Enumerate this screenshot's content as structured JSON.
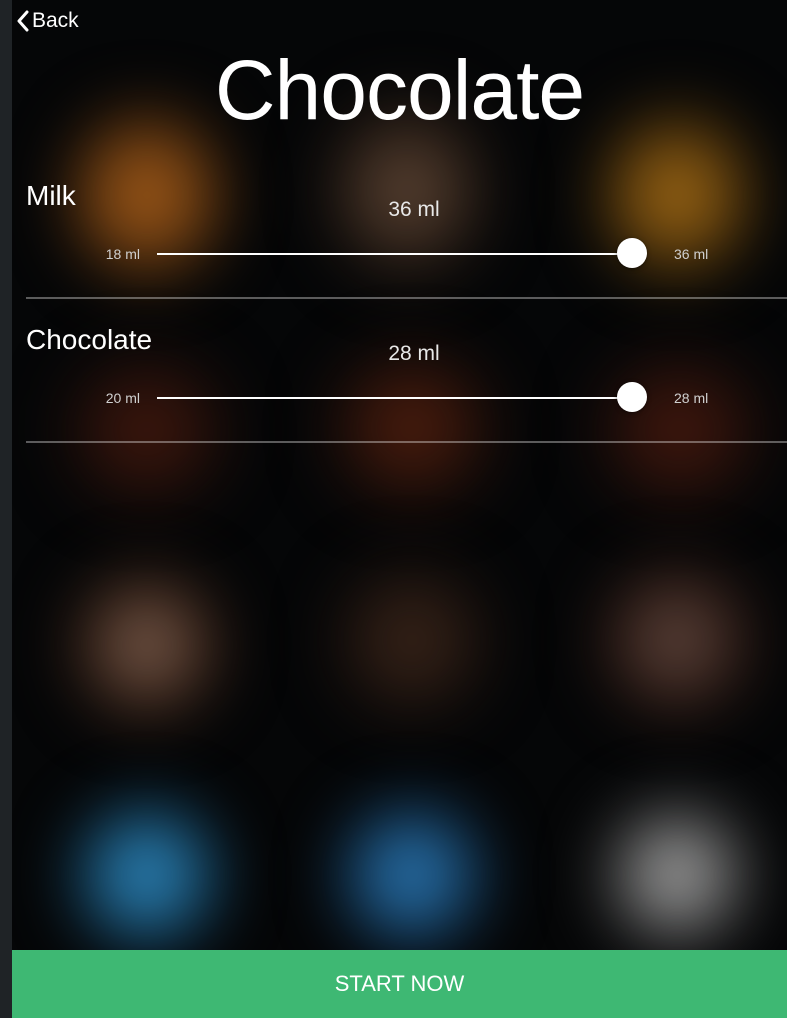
{
  "nav": {
    "back_label": "Back"
  },
  "page": {
    "title": "Chocolate"
  },
  "sliders": [
    {
      "label": "Milk",
      "value_text": "36 ml",
      "min_text": "18 ml",
      "max_text": "36 ml",
      "min": 18,
      "max": 36,
      "value": 36
    },
    {
      "label": "Chocolate",
      "value_text": "28 ml",
      "min_text": "20 ml",
      "max_text": "28 ml",
      "min": 20,
      "max": 28,
      "value": 28
    }
  ],
  "actions": {
    "start_label": "START NOW"
  },
  "colors": {
    "accent": "#3eb873",
    "background": "#050607"
  }
}
